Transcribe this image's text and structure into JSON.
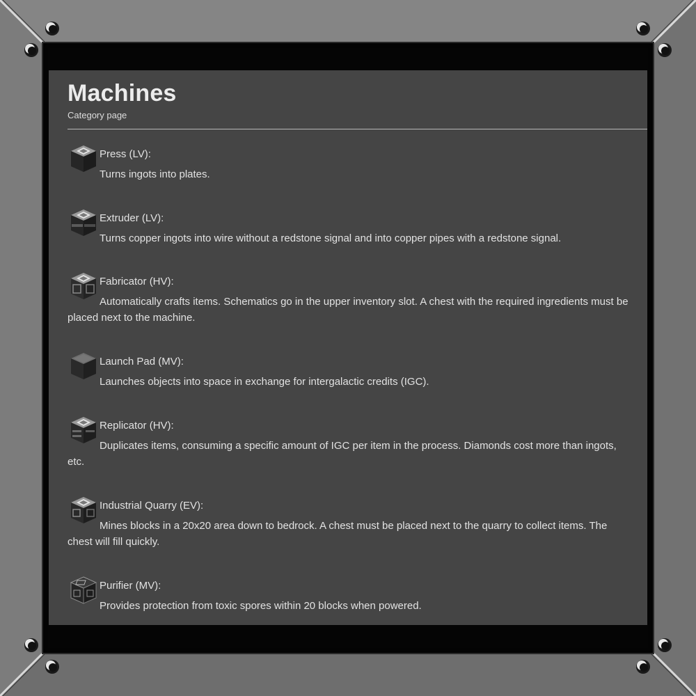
{
  "page": {
    "title": "Machines",
    "subtitle": "Category page"
  },
  "items": [
    {
      "icon": "press-icon",
      "title": "Press (LV):",
      "desc": "Turns ingots into plates."
    },
    {
      "icon": "extruder-icon",
      "title": "Extruder (LV):",
      "desc": "Turns copper ingots into wire without a redstone signal and into copper pipes with a redstone signal."
    },
    {
      "icon": "fabricator-icon",
      "title": "Fabricator (HV):",
      "desc": "Automatically crafts items. Schematics go in the upper inventory slot. A chest with the required ingredients must be placed next to the machine."
    },
    {
      "icon": "launch-pad-icon",
      "title": "Launch Pad (MV):",
      "desc": "Launches objects into space in exchange for intergalactic credits (IGC)."
    },
    {
      "icon": "replicator-icon",
      "title": "Replicator (HV):",
      "desc": "Duplicates items, consuming a specific amount of IGC per item in the process. Diamonds cost more than ingots, etc."
    },
    {
      "icon": "industrial-quarry-icon",
      "title": "Industrial Quarry (EV):",
      "desc": "Mines blocks in a 20x20 area down to bedrock. A chest must be placed next to the quarry to collect items. The chest will fill quickly."
    },
    {
      "icon": "purifier-icon",
      "title": "Purifier (MV):",
      "desc": "Provides protection from toxic spores within 20 blocks when powered."
    }
  ],
  "colors": {
    "frame": "#7a7a7a",
    "panel": "#454545",
    "border": "#050505",
    "text": "#e2e2e2"
  }
}
